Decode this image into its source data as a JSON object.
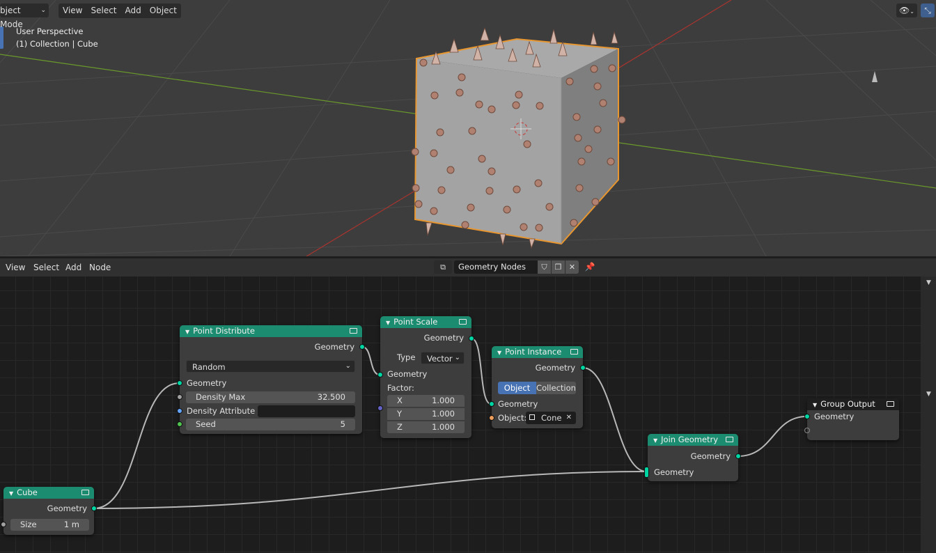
{
  "viewport": {
    "mode_label": "bject Mode",
    "menus": [
      "View",
      "Select",
      "Add",
      "Object"
    ],
    "overlay_line1": "User Perspective",
    "overlay_line2": "(1) Collection | Cube"
  },
  "node_editor": {
    "menus": [
      "View",
      "Select",
      "Add",
      "Node"
    ],
    "tree_name": "Geometry Nodes",
    "nodes": {
      "cube": {
        "title": "Cube",
        "out_geometry": "Geometry",
        "size_label": "Size",
        "size_value": "1 m"
      },
      "point_distribute": {
        "title": "Point Distribute",
        "out_geometry": "Geometry",
        "mode": "Random",
        "in_geometry": "Geometry",
        "density_max_label": "Density Max",
        "density_max_value": "32.500",
        "density_attribute_label": "Density Attribute",
        "seed_label": "Seed",
        "seed_value": "5"
      },
      "point_scale": {
        "title": "Point Scale",
        "out_geometry": "Geometry",
        "type_label": "Type",
        "type_value": "Vector",
        "in_geometry": "Geometry",
        "factor_label": "Factor:",
        "x_label": "X",
        "x_value": "1.000",
        "y_label": "Y",
        "y_value": "1.000",
        "z_label": "Z",
        "z_value": "1.000"
      },
      "point_instance": {
        "title": "Point Instance",
        "out_geometry": "Geometry",
        "tab_object": "Object",
        "tab_collection": "Collection",
        "in_geometry": "Geometry",
        "object_label": "Object:",
        "object_value": "Cone"
      },
      "join_geometry": {
        "title": "Join Geometry",
        "out_geometry": "Geometry",
        "in_geometry": "Geometry"
      },
      "group_output": {
        "title": "Group Output",
        "in_geometry": "Geometry"
      }
    }
  },
  "colors": {
    "node_header_geometry": "#1b8c6f",
    "node_header_output": "#1e1e1e",
    "socket_geometry": "#00d6a3",
    "selection_outline": "#e8962f",
    "axis_x": "#c0392b",
    "axis_y": "#6b9a2b"
  }
}
